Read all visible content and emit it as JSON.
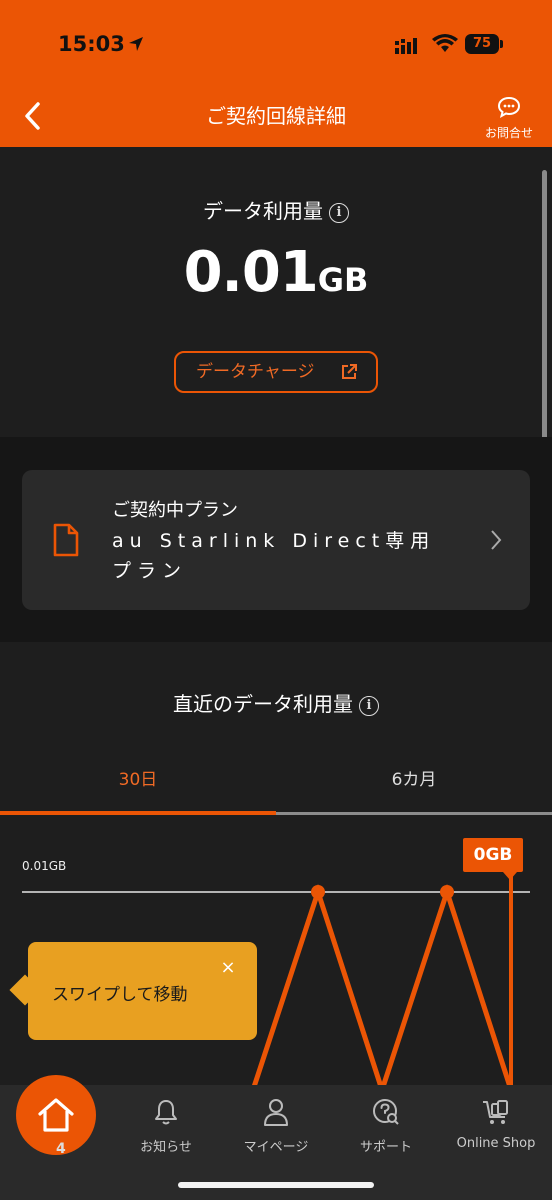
{
  "status_bar": {
    "time": "15:03",
    "battery": "75"
  },
  "header": {
    "title": "ご契約回線詳細",
    "contact_label": "お問合せ"
  },
  "usage": {
    "label": "データ利用量",
    "value": "0.01",
    "unit": "GB",
    "charge_button": "データチャージ"
  },
  "plan": {
    "title": "ご契約中プラン",
    "name": "au Starlink Direct専用プラン"
  },
  "recent": {
    "title": "直近のデータ利用量",
    "tabs": [
      {
        "label": "30日",
        "active": true
      },
      {
        "label": "6カ月",
        "active": false
      }
    ]
  },
  "chart_data": {
    "type": "line",
    "gridline_label": "0.01GB",
    "highlight_label": "0GB",
    "values": [
      0,
      0.01,
      0,
      0.01,
      0
    ],
    "ylim": [
      0,
      0.01
    ],
    "color": "#eb5505"
  },
  "swipe_tip": {
    "text": "スワイプして移動",
    "close": "×"
  },
  "bottom_nav": {
    "home_badge": "4",
    "items": [
      {
        "label": "お知らせ",
        "icon": "bell-icon"
      },
      {
        "label": "マイページ",
        "icon": "person-icon"
      },
      {
        "label": "サポート",
        "icon": "support-icon"
      },
      {
        "label": "Online Shop",
        "icon": "shop-cart-icon"
      }
    ]
  },
  "colors": {
    "accent": "#eb5505",
    "tooltip": "#e8a021",
    "background": "#1e1e1e"
  }
}
